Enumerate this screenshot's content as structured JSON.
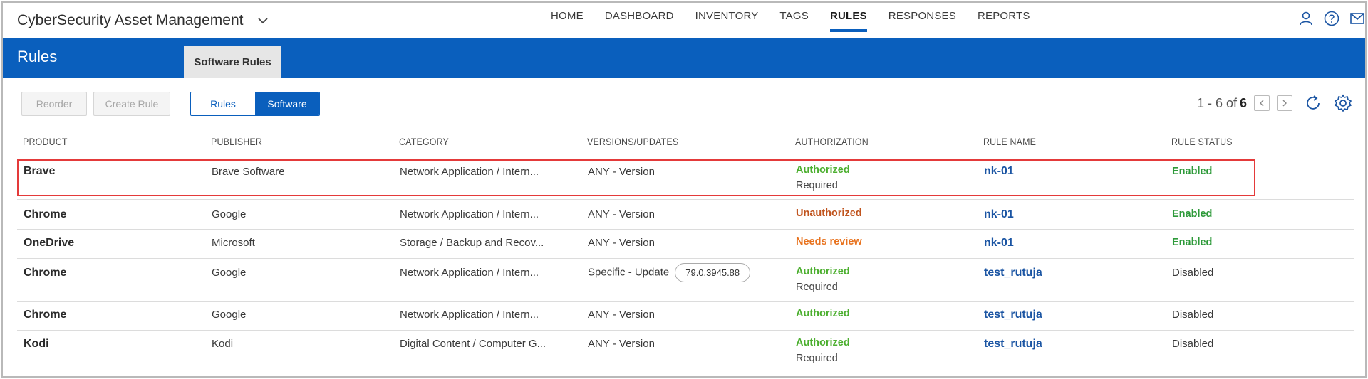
{
  "app": {
    "title": "CyberSecurity Asset Management"
  },
  "nav": [
    "HOME",
    "DASHBOARD",
    "INVENTORY",
    "TAGS",
    "RULES",
    "RESPONSES",
    "REPORTS"
  ],
  "nav_active": "RULES",
  "header": {
    "title": "Rules",
    "tab": "Software Rules"
  },
  "toolbar": {
    "reorder": "Reorder",
    "create_rule": "Create Rule",
    "seg_rules": "Rules",
    "seg_software": "Software"
  },
  "pager": {
    "range": "1 - 6 of",
    "total": "6"
  },
  "columns": [
    "PRODUCT",
    "PUBLISHER",
    "CATEGORY",
    "VERSIONS/UPDATES",
    "AUTHORIZATION",
    "RULE NAME",
    "RULE STATUS"
  ],
  "rows": [
    {
      "product": "Brave",
      "publisher": "Brave Software",
      "category": "Network Application / Intern...",
      "version": "ANY - Version",
      "version_pill": "",
      "auth": "Authorized",
      "auth_sub": "Required",
      "auth_color": "#4caf2f",
      "rule": "nk-01",
      "status": "Enabled"
    },
    {
      "product": "Chrome",
      "publisher": "Google",
      "category": "Network Application / Intern...",
      "version": "ANY - Version",
      "version_pill": "",
      "auth": "Unauthorized",
      "auth_sub": "",
      "auth_color": "#c0541e",
      "rule": "nk-01",
      "status": "Enabled"
    },
    {
      "product": "OneDrive",
      "publisher": "Microsoft",
      "category": "Storage / Backup and Recov...",
      "version": "ANY - Version",
      "version_pill": "",
      "auth": "Needs review",
      "auth_sub": "",
      "auth_color": "#e8731f",
      "rule": "nk-01",
      "status": "Enabled"
    },
    {
      "product": "Chrome",
      "publisher": "Google",
      "category": "Network Application / Intern...",
      "version": "Specific - Update",
      "version_pill": "79.0.3945.88",
      "auth": "Authorized",
      "auth_sub": "Required",
      "auth_color": "#4caf2f",
      "rule": "test_rutuja",
      "status": "Disabled"
    },
    {
      "product": "Chrome",
      "publisher": "Google",
      "category": "Network Application / Intern...",
      "version": "ANY - Version",
      "version_pill": "",
      "auth": "Authorized",
      "auth_sub": "",
      "auth_color": "#4caf2f",
      "rule": "test_rutuja",
      "status": "Disabled"
    },
    {
      "product": "Kodi",
      "publisher": "Kodi",
      "category": "Digital Content / Computer G...",
      "version": "ANY - Version",
      "version_pill": "",
      "auth": "Authorized",
      "auth_sub": "Required",
      "auth_color": "#4caf2f",
      "rule": "test_rutuja",
      "status": "Disabled"
    }
  ],
  "icons": {
    "app_menu": "chevron-down-icon",
    "user": "user-icon",
    "help": "help-icon",
    "mail": "mail-icon",
    "prev": "chevron-left-icon",
    "next": "chevron-right-icon",
    "refresh": "refresh-icon",
    "settings": "gear-icon"
  }
}
